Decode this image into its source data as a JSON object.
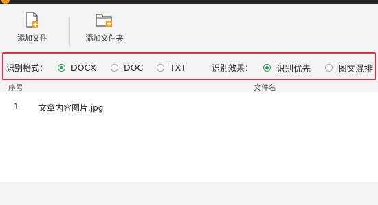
{
  "toolbar": {
    "add_file_label": "添加文件",
    "add_folder_label": "添加文件夹",
    "add_file_icon": "add-file-icon",
    "add_folder_icon": "add-folder-icon"
  },
  "options": {
    "format_label": "识别格式：",
    "formats": [
      {
        "label": "DOCX",
        "checked": true
      },
      {
        "label": "DOC",
        "checked": false
      },
      {
        "label": "TXT",
        "checked": false
      }
    ],
    "effect_label": "识别效果：",
    "effects": [
      {
        "label": "识别优先",
        "checked": true
      },
      {
        "label": "图文混排",
        "checked": false
      }
    ]
  },
  "table": {
    "columns": [
      "序号",
      "文件名"
    ],
    "rows": [
      {
        "index": "1",
        "name": "文章内容图片.jpg"
      }
    ]
  },
  "colors": {
    "accent_green": "#2a9d55",
    "highlight_red": "#d9344a",
    "icon_orange": "#f2a21a"
  }
}
